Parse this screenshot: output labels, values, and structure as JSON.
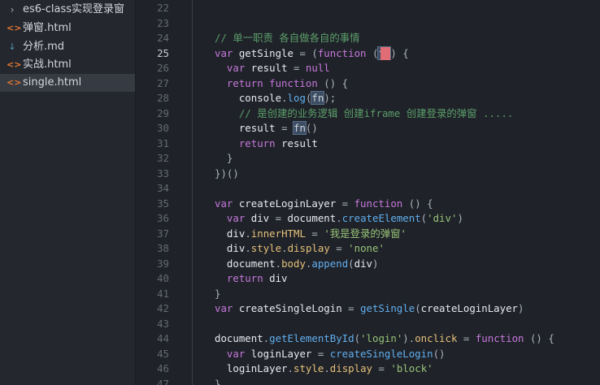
{
  "sidebar": {
    "items": [
      {
        "icon": "chevron-right-icon",
        "glyph": "›",
        "label": "es6-class实现登录窗",
        "active": false
      },
      {
        "icon": "html-file-icon",
        "glyph": "<>",
        "label": "弹窗.html",
        "active": false
      },
      {
        "icon": "markdown-file-icon",
        "glyph": "↓",
        "label": "分析.md",
        "active": false
      },
      {
        "icon": "html-file-icon",
        "glyph": "<>",
        "label": "实战.html",
        "active": false
      },
      {
        "icon": "html-file-icon",
        "glyph": "<>",
        "label": "single.html",
        "active": true
      }
    ]
  },
  "editor": {
    "current_line": 25,
    "lines": [
      {
        "n": "22",
        "tokens": []
      },
      {
        "n": "23",
        "tokens": []
      },
      {
        "n": "24",
        "tokens": [
          [
            "cm",
            "// 单一职责 各自做各自的事情"
          ]
        ]
      },
      {
        "n": "25",
        "tokens": [
          [
            "kw",
            "var "
          ],
          [
            "vr",
            "getSingle "
          ],
          [
            "pn",
            "= ("
          ],
          [
            "kw",
            "function "
          ],
          [
            "pn",
            "("
          ],
          [
            "hl",
            "fn"
          ],
          [
            "pn",
            ") {"
          ]
        ]
      },
      {
        "n": "26",
        "tokens": [
          [
            "kw",
            "  var "
          ],
          [
            "vr",
            "result "
          ],
          [
            "pn",
            "= "
          ],
          [
            "nl",
            "null"
          ]
        ]
      },
      {
        "n": "27",
        "tokens": [
          [
            "kw",
            "  return function "
          ],
          [
            "pn",
            "() {"
          ]
        ]
      },
      {
        "n": "28",
        "tokens": [
          [
            "vr",
            "    console"
          ],
          [
            "pn",
            "."
          ],
          [
            "fn",
            "log"
          ],
          [
            "pn",
            "("
          ],
          [
            "hl",
            "fn"
          ],
          [
            "pn",
            ");"
          ]
        ]
      },
      {
        "n": "29",
        "tokens": [
          [
            "cm",
            "    // 是创建的业务逻辑 创建iframe 创建登录的弹窗 ....."
          ]
        ]
      },
      {
        "n": "30",
        "tokens": [
          [
            "vr",
            "    result "
          ],
          [
            "pn",
            "= "
          ],
          [
            "hl",
            "fn"
          ],
          [
            "pn",
            "()"
          ]
        ]
      },
      {
        "n": "31",
        "tokens": [
          [
            "kw",
            "    return "
          ],
          [
            "vr",
            "result"
          ]
        ]
      },
      {
        "n": "32",
        "tokens": [
          [
            "pn",
            "  }"
          ]
        ]
      },
      {
        "n": "33",
        "tokens": [
          [
            "pn",
            "})()"
          ]
        ]
      },
      {
        "n": "34",
        "tokens": []
      },
      {
        "n": "35",
        "tokens": [
          [
            "kw",
            "var "
          ],
          [
            "vr",
            "createLoginLayer "
          ],
          [
            "pn",
            "= "
          ],
          [
            "kw",
            "function "
          ],
          [
            "pn",
            "() {"
          ]
        ]
      },
      {
        "n": "36",
        "tokens": [
          [
            "kw",
            "  var "
          ],
          [
            "vr",
            "div "
          ],
          [
            "pn",
            "= "
          ],
          [
            "vr",
            "document"
          ],
          [
            "pn",
            "."
          ],
          [
            "fn",
            "createElement"
          ],
          [
            "pn",
            "("
          ],
          [
            "str",
            "'div'"
          ],
          [
            "pn",
            ")"
          ]
        ]
      },
      {
        "n": "37",
        "tokens": [
          [
            "vr",
            "  div"
          ],
          [
            "pn",
            "."
          ],
          [
            "pr",
            "innerHTML "
          ],
          [
            "pn",
            "= "
          ],
          [
            "str",
            "'我是登录的弹窗'"
          ]
        ]
      },
      {
        "n": "38",
        "tokens": [
          [
            "vr",
            "  div"
          ],
          [
            "pn",
            "."
          ],
          [
            "pr",
            "style"
          ],
          [
            "pn",
            "."
          ],
          [
            "pr",
            "display "
          ],
          [
            "pn",
            "= "
          ],
          [
            "str",
            "'none'"
          ]
        ]
      },
      {
        "n": "39",
        "tokens": [
          [
            "vr",
            "  document"
          ],
          [
            "pn",
            "."
          ],
          [
            "pr",
            "body"
          ],
          [
            "pn",
            "."
          ],
          [
            "fn",
            "append"
          ],
          [
            "pn",
            "("
          ],
          [
            "vr",
            "div"
          ],
          [
            "pn",
            ")"
          ]
        ]
      },
      {
        "n": "40",
        "tokens": [
          [
            "kw",
            "  return "
          ],
          [
            "vr",
            "div"
          ]
        ]
      },
      {
        "n": "41",
        "tokens": [
          [
            "pn",
            "}"
          ]
        ]
      },
      {
        "n": "42",
        "tokens": [
          [
            "kw",
            "var "
          ],
          [
            "vr",
            "createSingleLogin "
          ],
          [
            "pn",
            "= "
          ],
          [
            "fn",
            "getSingle"
          ],
          [
            "pn",
            "("
          ],
          [
            "vr",
            "createLoginLayer"
          ],
          [
            "pn",
            ")"
          ]
        ]
      },
      {
        "n": "43",
        "tokens": []
      },
      {
        "n": "44",
        "tokens": [
          [
            "vr",
            "document"
          ],
          [
            "pn",
            "."
          ],
          [
            "fn",
            "getElementById"
          ],
          [
            "pn",
            "("
          ],
          [
            "str",
            "'login'"
          ],
          [
            "pn",
            ")."
          ],
          [
            "pr",
            "onclick "
          ],
          [
            "pn",
            "= "
          ],
          [
            "kw",
            "function "
          ],
          [
            "pn",
            "() {"
          ]
        ]
      },
      {
        "n": "45",
        "tokens": [
          [
            "kw",
            "  var "
          ],
          [
            "vr",
            "loginLayer "
          ],
          [
            "pn",
            "= "
          ],
          [
            "fn",
            "createSingleLogin"
          ],
          [
            "pn",
            "()"
          ]
        ]
      },
      {
        "n": "46",
        "tokens": [
          [
            "vr",
            "  loginLayer"
          ],
          [
            "pn",
            "."
          ],
          [
            "pr",
            "style"
          ],
          [
            "pn",
            "."
          ],
          [
            "pr",
            "display "
          ],
          [
            "pn",
            "= "
          ],
          [
            "str",
            "'block'"
          ]
        ]
      },
      {
        "n": "47",
        "tokens": [
          [
            "pn",
            "}"
          ]
        ]
      }
    ]
  }
}
